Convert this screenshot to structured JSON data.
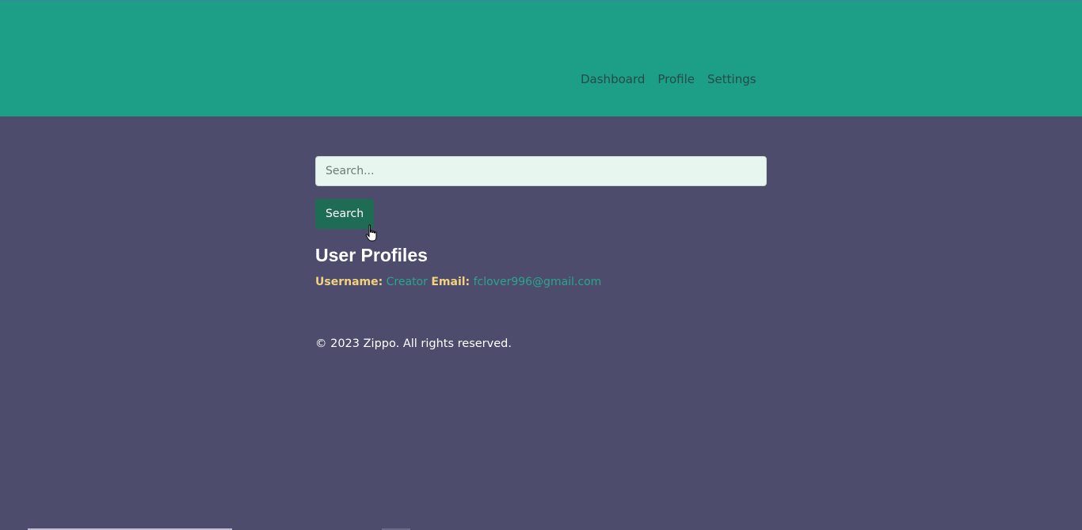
{
  "nav": {
    "items": [
      {
        "label": "Dashboard"
      },
      {
        "label": "Profile"
      },
      {
        "label": "Settings"
      }
    ]
  },
  "search": {
    "placeholder": "Search...",
    "value": "",
    "button_label": "Search"
  },
  "profiles": {
    "title": "User Profiles",
    "username_label": "Username:",
    "username_value": "Creator",
    "email_label": "Email:",
    "email_value": "fclover996@gmail.com"
  },
  "footer": {
    "text": "© 2023 Zippo. All rights reserved."
  },
  "colors": {
    "header_bg": "#1c9e87",
    "page_bg": "#4d4c6d",
    "button_bg": "#1f6c54",
    "label": "#f3d27f",
    "value": "#2aa58c"
  },
  "icons": {
    "cursor": "hand-pointer-icon"
  }
}
